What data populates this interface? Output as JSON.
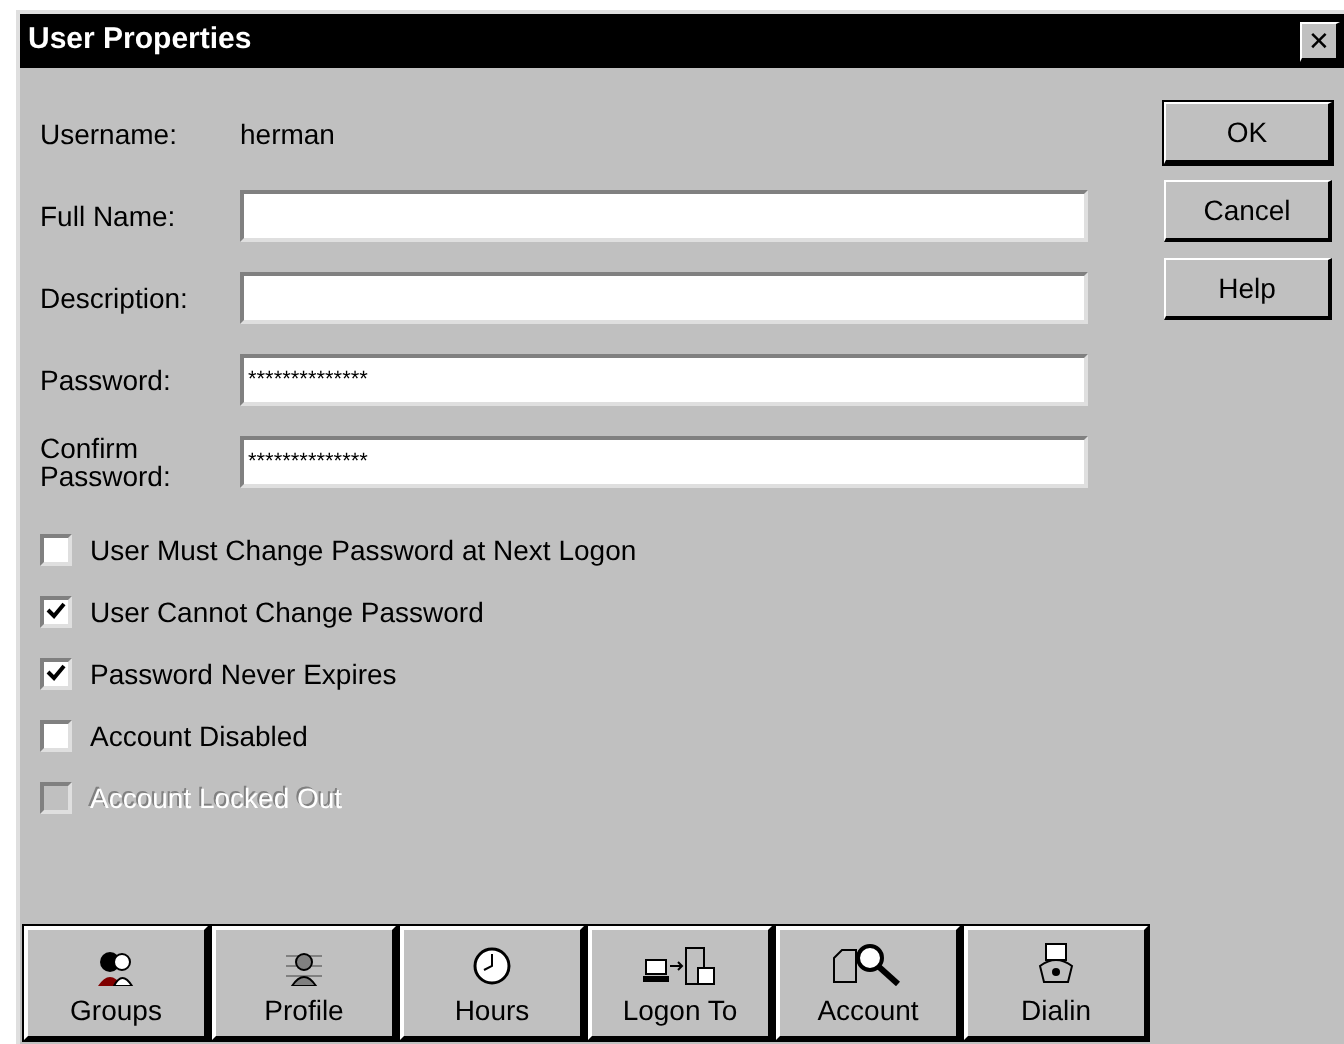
{
  "window": {
    "title": "User Properties",
    "close": "✕"
  },
  "username": {
    "label": "Username:",
    "value": "herman"
  },
  "fields": [
    {
      "label": "Full Name:"
    },
    {
      "label": "Description:"
    },
    {
      "label": "Password:",
      "value": "**************"
    },
    {
      "label": "Confirm Password:",
      "value": "**************"
    }
  ],
  "buttons": [
    {
      "label": "OK",
      "default": true
    },
    {
      "label": "Cancel",
      "default": false
    },
    {
      "label": "Help",
      "default": false
    }
  ],
  "options": [
    {
      "label": "User Must Change Password at Next Logon",
      "checked": false,
      "disabled": false
    },
    {
      "label": "User Cannot Change Password",
      "checked": true,
      "disabled": false
    },
    {
      "label": "Password Never Expires",
      "checked": true,
      "disabled": false
    },
    {
      "label": "Account Disabled",
      "checked": false,
      "disabled": false
    },
    {
      "label": "Account Locked Out",
      "checked": false,
      "disabled": true
    }
  ],
  "tools": [
    {
      "label": "Groups",
      "kind": "groups"
    },
    {
      "label": "Profile",
      "kind": "profile"
    },
    {
      "label": "Hours",
      "kind": "hours"
    },
    {
      "label": "Logon To",
      "kind": "logon"
    },
    {
      "label": "Account",
      "kind": "account"
    },
    {
      "label": "Dialin",
      "kind": "dialin"
    }
  ]
}
